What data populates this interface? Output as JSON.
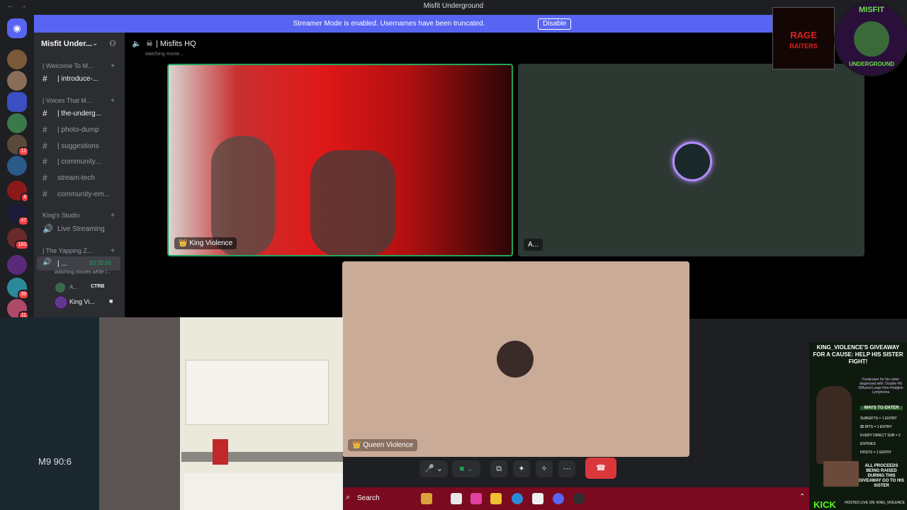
{
  "window": {
    "title": "Misfit Underground"
  },
  "banner": {
    "text": "Streamer Mode is enabled. Usernames have been truncated.",
    "button": "Disable"
  },
  "server": {
    "name": "Misfit Under..."
  },
  "channels": [
    {
      "type": "category",
      "label": "| Welcome To M..."
    },
    {
      "type": "text",
      "label": "| introduce-...",
      "active": true
    },
    {
      "type": "category",
      "label": "| Voices That M..."
    },
    {
      "type": "text",
      "label": "| the-underg...",
      "active": true
    },
    {
      "type": "text",
      "label": "| photo-dump"
    },
    {
      "type": "text",
      "label": "| suggestions"
    },
    {
      "type": "text",
      "label": "| community..."
    },
    {
      "type": "text",
      "label": "stream-tech"
    },
    {
      "type": "text",
      "label": "community-em..."
    },
    {
      "type": "category",
      "label": "King's Studio"
    },
    {
      "type": "voice",
      "label": "Live Streaming"
    },
    {
      "type": "category",
      "label": "| The Yapping Z..."
    }
  ],
  "active_voice": {
    "label": "| ...",
    "timer": "33:32:55",
    "status": "watching movies while i..."
  },
  "voice_members": [
    {
      "name": "A...",
      "tag": "CTRB"
    },
    {
      "name": "King Vi..."
    }
  ],
  "voice_channel_header": {
    "title": "Misfits HQ",
    "status": "watching movie..."
  },
  "tiles": [
    {
      "name": "King Violence"
    },
    {
      "name": "A..."
    },
    {
      "name": "Queen Violence"
    }
  ],
  "webcam": {
    "clock": "M9 90:6"
  },
  "taskbar": {
    "search": "Search"
  },
  "overlays": {
    "rage_logo": "RAGE BAITERS",
    "misfit_logo": "MISFIT UNDERGROUND"
  },
  "poster": {
    "title": "KING_VIOLENCE'S GIVEAWAY FOR A CAUSE: HELP HIS SISTER FIGHT!",
    "subtitle": "Fundraiser for his sister diagnosed with: Double-Hit Diffused Large Non-Hodgkin Lymphoma",
    "ways": "WAYS TO ENTER",
    "entries": [
      "SUBGIFTS = 1 ENTRY",
      "$5 BITS = 1 ENTRY",
      "EVERY DIRECT SUB = 2 ENTRIES",
      "HOSTS = 1 ENTRY"
    ],
    "proceeds": "ALL PROCEEDS BEING RAISED DURING THIS GIVEAWAY GO TO HIS SISTER",
    "footer": "KICK",
    "footer_sub": "HOSTED LIVE ON: KING_VIOLENCE"
  }
}
